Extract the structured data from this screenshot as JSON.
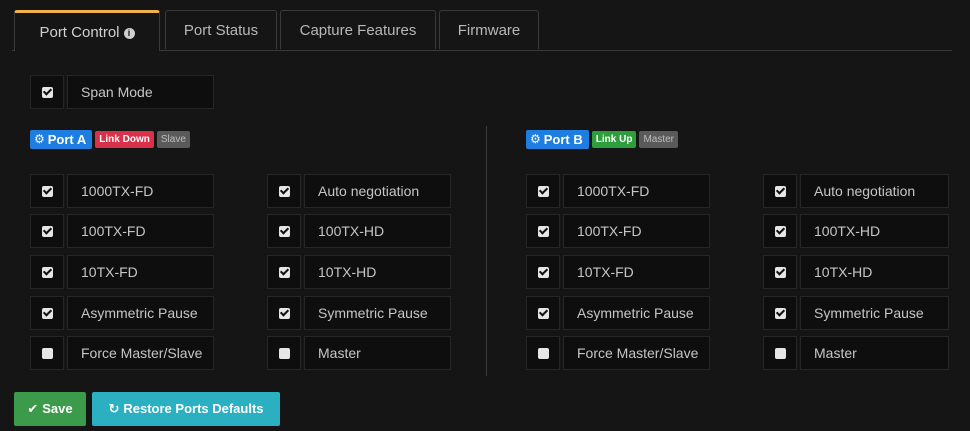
{
  "tabs": [
    {
      "label": "Port Control",
      "active": true,
      "has_info": true
    },
    {
      "label": "Port Status"
    },
    {
      "label": "Capture Features"
    },
    {
      "label": "Firmware"
    }
  ],
  "span_mode": {
    "label": "Span Mode",
    "checked": true
  },
  "port_a": {
    "label": "Port A",
    "link": "Link Down",
    "role": "Slave",
    "options": [
      {
        "label": "1000TX-FD",
        "checked": true
      },
      {
        "label": "Auto negotiation",
        "checked": true
      },
      {
        "label": "100TX-FD",
        "checked": true
      },
      {
        "label": "100TX-HD",
        "checked": true
      },
      {
        "label": "10TX-FD",
        "checked": true
      },
      {
        "label": "10TX-HD",
        "checked": true
      },
      {
        "label": "Asymmetric Pause",
        "checked": true
      },
      {
        "label": "Symmetric Pause",
        "checked": true
      },
      {
        "label": "Force Master/Slave",
        "checked": false
      },
      {
        "label": "Master",
        "checked": false
      }
    ]
  },
  "port_b": {
    "label": "Port B",
    "link": "Link Up",
    "role": "Master",
    "options": [
      {
        "label": "1000TX-FD",
        "checked": true
      },
      {
        "label": "Auto negotiation",
        "checked": true
      },
      {
        "label": "100TX-FD",
        "checked": true
      },
      {
        "label": "100TX-HD",
        "checked": true
      },
      {
        "label": "10TX-FD",
        "checked": true
      },
      {
        "label": "10TX-HD",
        "checked": true
      },
      {
        "label": "Asymmetric Pause",
        "checked": true
      },
      {
        "label": "Symmetric Pause",
        "checked": true
      },
      {
        "label": "Force Master/Slave",
        "checked": false
      },
      {
        "label": "Master",
        "checked": false
      }
    ]
  },
  "buttons": {
    "save": "Save",
    "restore": "Restore Ports Defaults"
  },
  "colors": {
    "accent": "#f0b24a",
    "port_badge": "#1e7de0",
    "link_down": "#d9314a",
    "link_up": "#2e9e3c",
    "save": "#3b9b4a",
    "restore": "#2ab0c0"
  },
  "icons": {
    "tab_info": "info-icon",
    "port": "gear-icon",
    "save": "checkmark-icon",
    "restore": "refresh-icon"
  }
}
